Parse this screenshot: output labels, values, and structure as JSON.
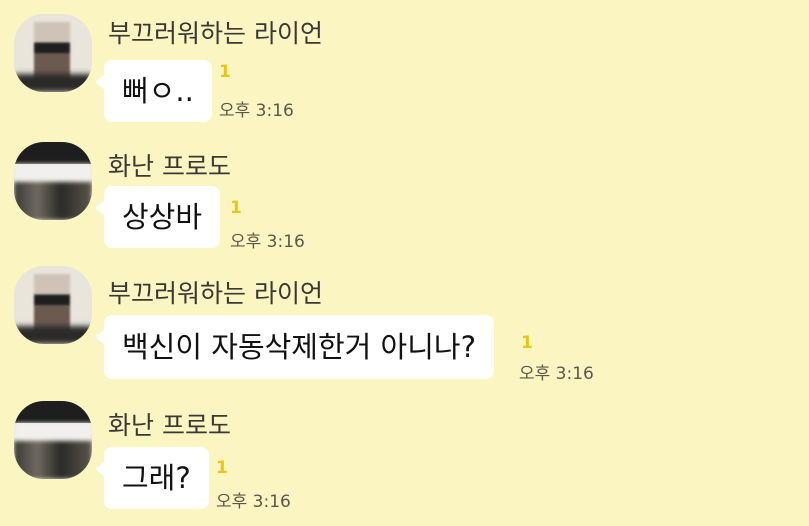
{
  "messages": [
    {
      "sender": "부끄러워하는 라이언",
      "text": "뻐ㅇ..",
      "unread": "1",
      "time": "오후 3:16",
      "avatar": "ryan-avatar"
    },
    {
      "sender": "화난 프로도",
      "text": "상상바",
      "unread": "1",
      "time": "오후 3:16",
      "avatar": "frodo-avatar"
    },
    {
      "sender": "부끄러워하는 라이언",
      "text": "백신이 자동삭제한거 아니나?",
      "unread": "1",
      "time": "오후 3:16",
      "avatar": "ryan-avatar"
    },
    {
      "sender": "화난 프로도",
      "text": "그래?",
      "unread": "1",
      "time": "오후 3:16",
      "avatar": "frodo-avatar"
    }
  ],
  "colors": {
    "background": "#fbf5c2",
    "bubble": "#ffffff",
    "unread": "#e8c51b"
  }
}
